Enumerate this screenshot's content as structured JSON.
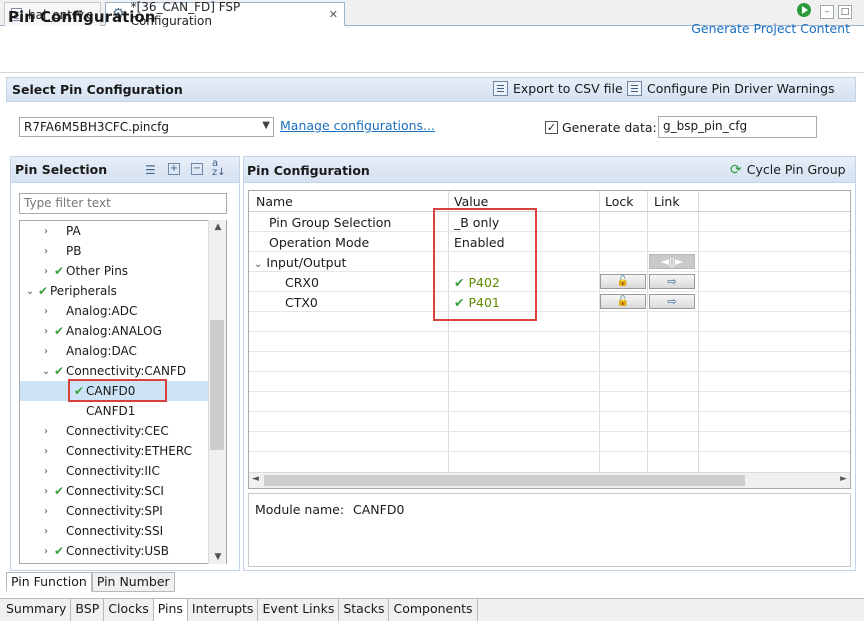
{
  "tabs": [
    {
      "label": "hal_entry.c",
      "active": false
    },
    {
      "label": "*[36_CAN_FD] FSP Configuration",
      "active": true
    }
  ],
  "tab_close_glyph": "✕",
  "header": {
    "title": "Pin Configuration",
    "generate_label": "Generate Project Content"
  },
  "select_config": {
    "title": "Select Pin Configuration",
    "export_label": "Export to CSV file",
    "warnings_label": "Configure Pin Driver Warnings",
    "file_value": "R7FA6M5BH3CFC.pincfg",
    "manage_label": "Manage configurations...",
    "generate_data_label": "Generate data:",
    "generate_data_checked": true,
    "generate_data_value": "g_bsp_pin_cfg"
  },
  "pin_selection": {
    "title": "Pin Selection",
    "filter_placeholder": "Type filter text",
    "items": [
      {
        "label": "PA",
        "twisty": "›",
        "check": "",
        "selected": false
      },
      {
        "label": "PB",
        "twisty": "›",
        "check": "",
        "selected": false
      },
      {
        "label": "Other Pins",
        "twisty": "›",
        "check": "✔",
        "selected": false
      },
      {
        "label": "Peripherals",
        "twisty": "⌄",
        "check": "✔",
        "selected": false
      },
      {
        "label": "Analog:ADC",
        "twisty": "›",
        "check": "",
        "selected": false
      },
      {
        "label": "Analog:ANALOG",
        "twisty": "›",
        "check": "✔",
        "selected": false
      },
      {
        "label": "Analog:DAC",
        "twisty": "›",
        "check": "",
        "selected": false
      },
      {
        "label": "Connectivity:CANFD",
        "twisty": "⌄",
        "check": "✔",
        "selected": false
      },
      {
        "label": "CANFD0",
        "twisty": "",
        "check": "✔",
        "selected": true
      },
      {
        "label": "CANFD1",
        "twisty": "",
        "check": "",
        "selected": false
      },
      {
        "label": "Connectivity:CEC",
        "twisty": "›",
        "check": "",
        "selected": false
      },
      {
        "label": "Connectivity:ETHERC",
        "twisty": "›",
        "check": "",
        "selected": false
      },
      {
        "label": "Connectivity:IIC",
        "twisty": "›",
        "check": "",
        "selected": false
      },
      {
        "label": "Connectivity:SCI",
        "twisty": "›",
        "check": "✔",
        "selected": false
      },
      {
        "label": "Connectivity:SPI",
        "twisty": "›",
        "check": "",
        "selected": false
      },
      {
        "label": "Connectivity:SSI",
        "twisty": "›",
        "check": "",
        "selected": false
      },
      {
        "label": "Connectivity:USB",
        "twisty": "›",
        "check": "✔",
        "selected": false
      }
    ]
  },
  "pin_config": {
    "title": "Pin Configuration",
    "cycle_label": "Cycle Pin Group",
    "columns": {
      "name": "Name",
      "value": "Value",
      "lock": "Lock",
      "link": "Link"
    },
    "rows": {
      "pin_group": {
        "name": "Pin Group Selection",
        "value": "_B only"
      },
      "op_mode": {
        "name": "Operation Mode",
        "value": "Enabled"
      },
      "io": {
        "name": "Input/Output"
      },
      "crx0": {
        "name": "CRX0",
        "value": "P402"
      },
      "ctx0": {
        "name": "CTX0",
        "value": "P401"
      }
    },
    "module_label": "Module name:",
    "module_value": "CANFD0"
  },
  "bottom_tabs_1": [
    "Pin Function",
    "Pin Number"
  ],
  "bottom_tabs_2": [
    "Summary",
    "BSP",
    "Clocks",
    "Pins",
    "Interrupts",
    "Event Links",
    "Stacks",
    "Components"
  ],
  "bottom_tabs_2_active": "Pins",
  "colors": {
    "accent": "#1b6fbf",
    "check_green": "#3aa23a",
    "highlight_red": "#d9413f",
    "selection": "#cde4f7"
  }
}
